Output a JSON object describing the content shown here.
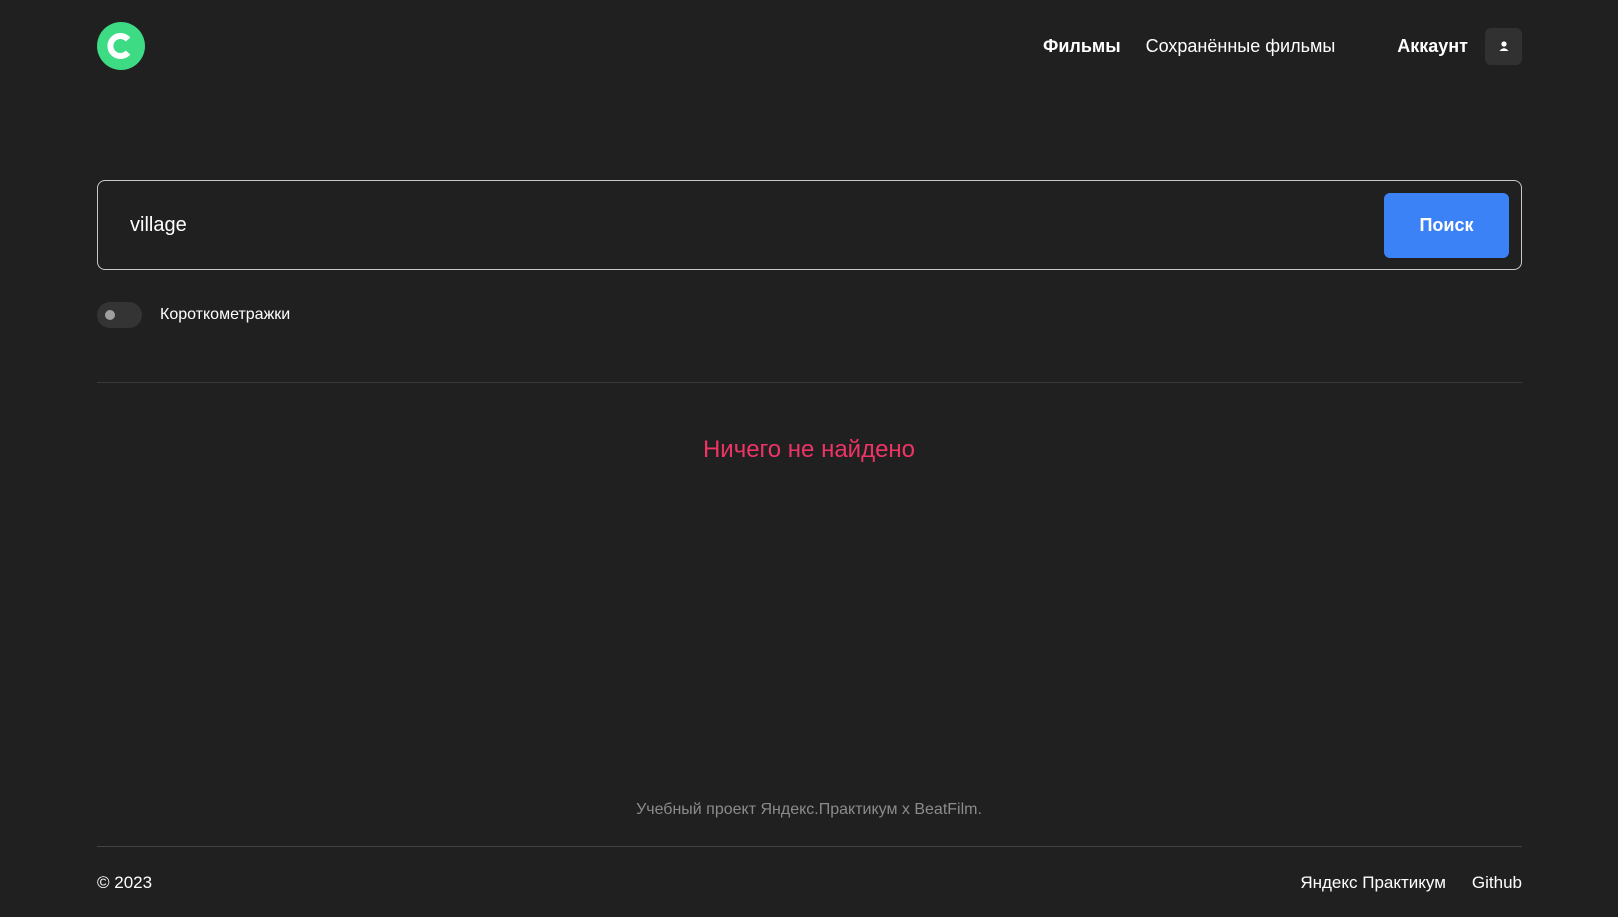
{
  "header": {
    "logo_icon": "logo-c-icon",
    "nav": {
      "movies": "Фильмы",
      "saved_movies": "Сохранённые фильмы"
    },
    "account": {
      "label": "Аккаунт",
      "icon": "user-icon"
    }
  },
  "search": {
    "value": "village",
    "button_label": "Поиск"
  },
  "filter": {
    "label": "Короткометражки",
    "enabled": false
  },
  "results": {
    "empty_message": "Ничего не найдено"
  },
  "footer": {
    "caption": "Учебный проект Яндекс.Практикум х BeatFilm.",
    "copyright": "© 2023",
    "links": [
      "Яндекс Практикум",
      "Github"
    ]
  },
  "colors": {
    "background": "#202020",
    "accent_green": "#3ddc84",
    "button_blue": "#3b82f6",
    "error_pink": "#ee3465"
  }
}
